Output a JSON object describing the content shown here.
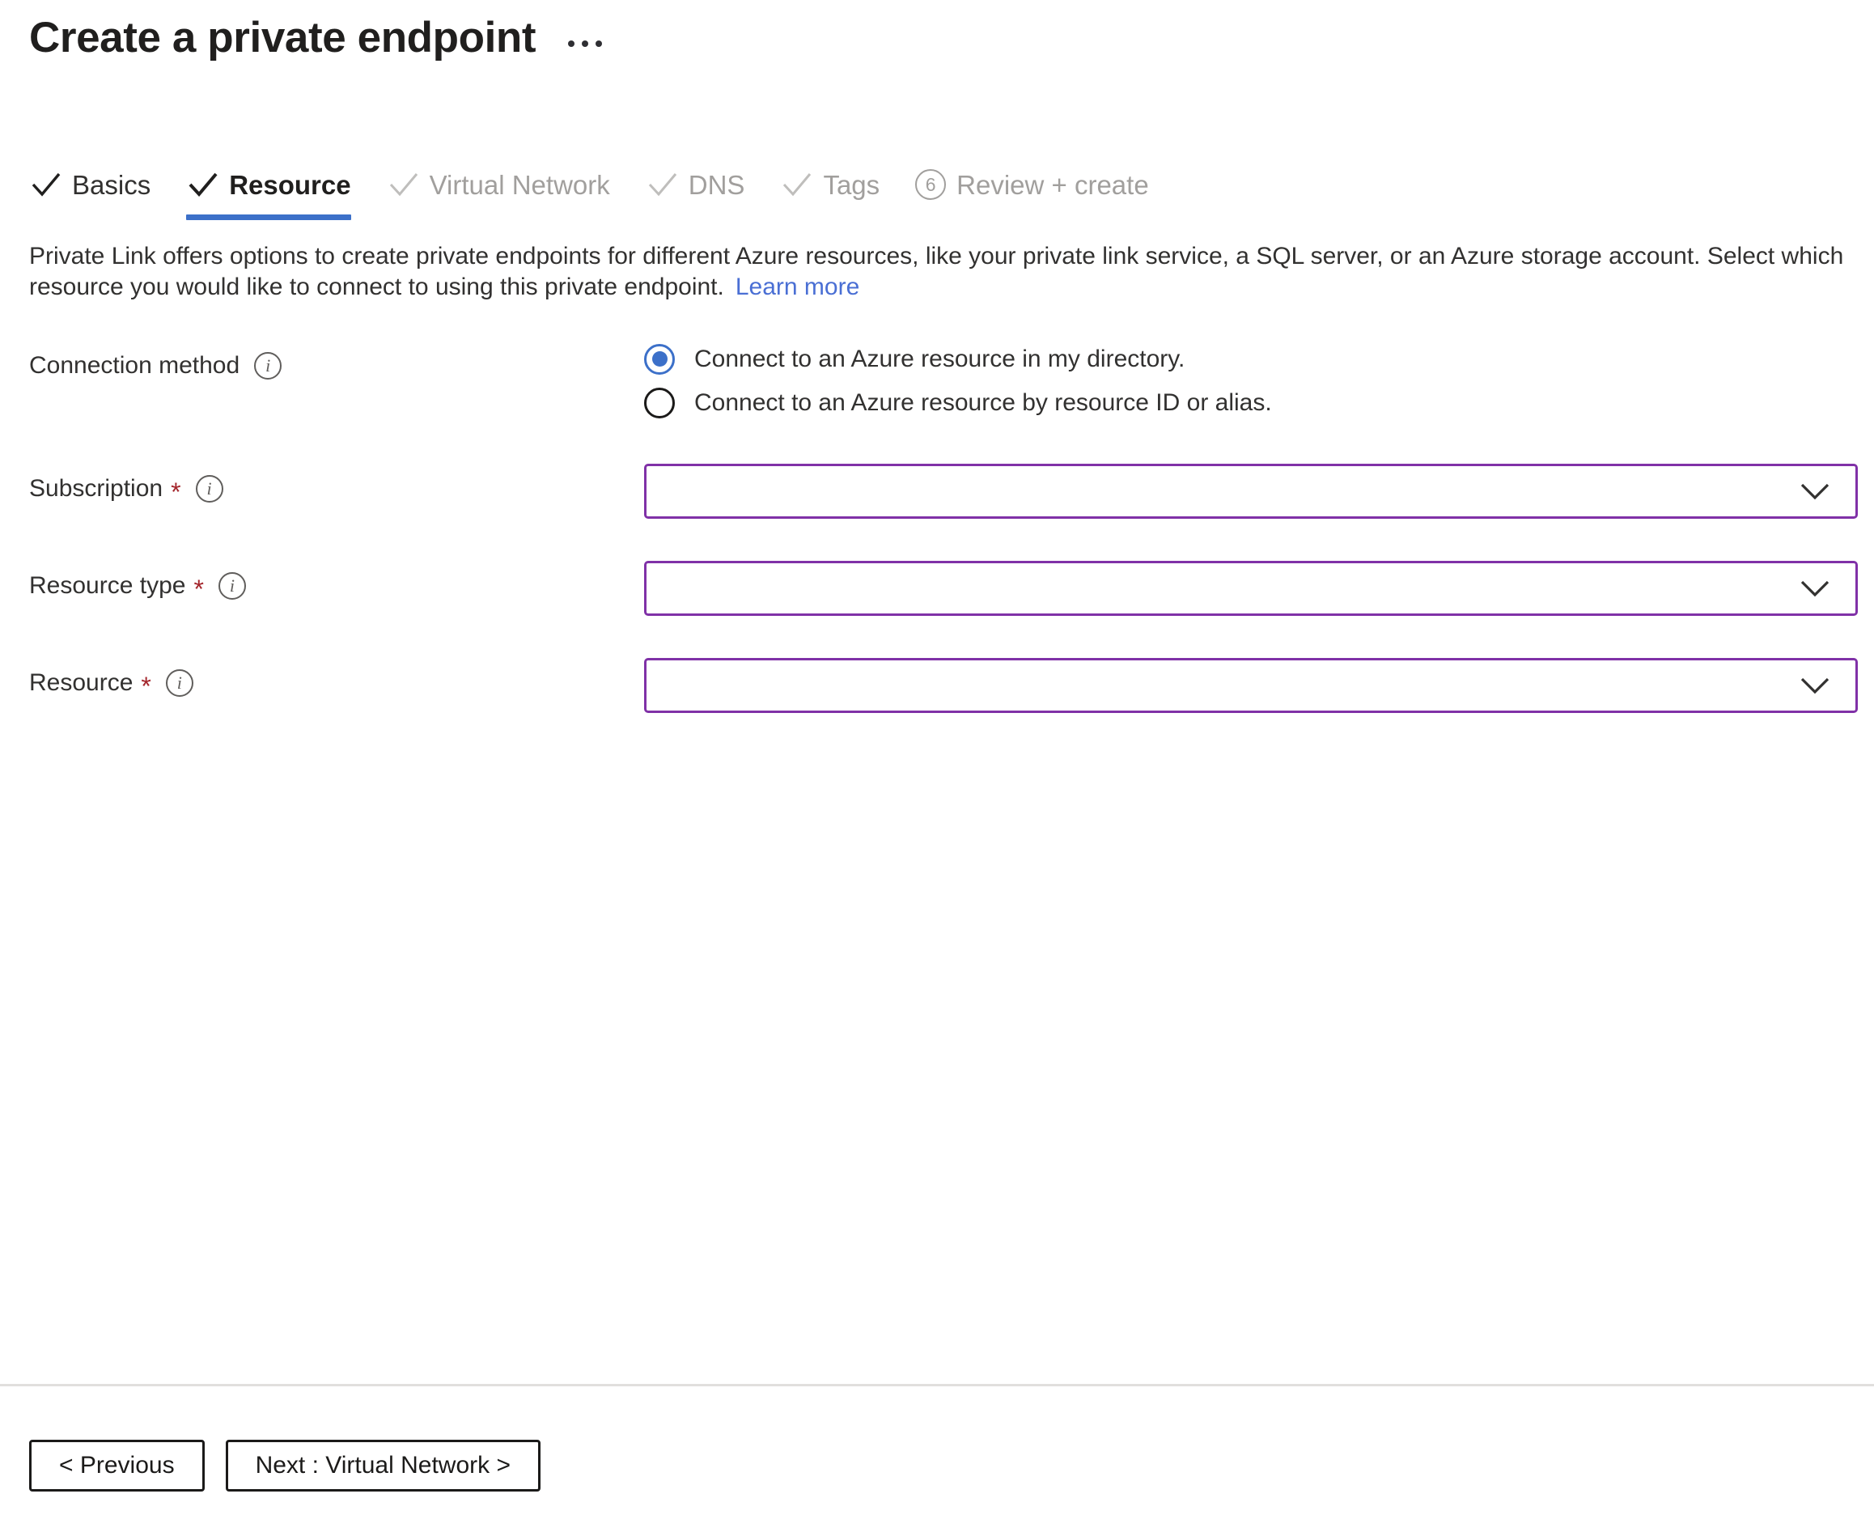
{
  "header": {
    "title": "Create a private endpoint",
    "more_menu": "…"
  },
  "tabs": [
    {
      "label": "Basics",
      "state": "done",
      "icon": "check-icon"
    },
    {
      "label": "Resource",
      "state": "active",
      "icon": "check-icon"
    },
    {
      "label": "Virtual Network",
      "state": "pending",
      "icon": "check-icon"
    },
    {
      "label": "DNS",
      "state": "pending",
      "icon": "check-icon"
    },
    {
      "label": "Tags",
      "state": "pending",
      "icon": "check-icon"
    },
    {
      "label": "Review + create",
      "state": "pending",
      "icon": "step-number",
      "step": "6"
    }
  ],
  "description": {
    "text": "Private Link offers options to create private endpoints for different Azure resources, like your private link service, a SQL server, or an Azure storage account. Select which resource you would like to connect to using this private endpoint.",
    "link_label": "Learn more"
  },
  "form": {
    "connection_method": {
      "label": "Connection method",
      "info_icon": "info-icon",
      "options": [
        {
          "label": "Connect to an Azure resource in my directory.",
          "checked": true
        },
        {
          "label": "Connect to an Azure resource by resource ID or alias.",
          "checked": false
        }
      ]
    },
    "subscription": {
      "label": "Subscription",
      "required_marker": "*",
      "info_icon": "info-icon",
      "value": "",
      "placeholder": "",
      "chevron_icon": "chevron-down-icon"
    },
    "resource_type": {
      "label": "Resource type",
      "required_marker": "*",
      "info_icon": "info-icon",
      "value": "",
      "placeholder": "",
      "chevron_icon": "chevron-down-icon"
    },
    "resource": {
      "label": "Resource",
      "required_marker": "*",
      "info_icon": "info-icon",
      "value": "",
      "placeholder": "",
      "chevron_icon": "chevron-down-icon"
    }
  },
  "footer": {
    "previous_label": "< Previous",
    "next_label": "Next : Virtual Network >"
  },
  "colors": {
    "accent_blue": "#3c70c9",
    "link_blue": "#4a6fd4",
    "field_border_purple": "#8031a7",
    "required_red": "#a4262c",
    "muted_gray": "#a19f9d"
  }
}
